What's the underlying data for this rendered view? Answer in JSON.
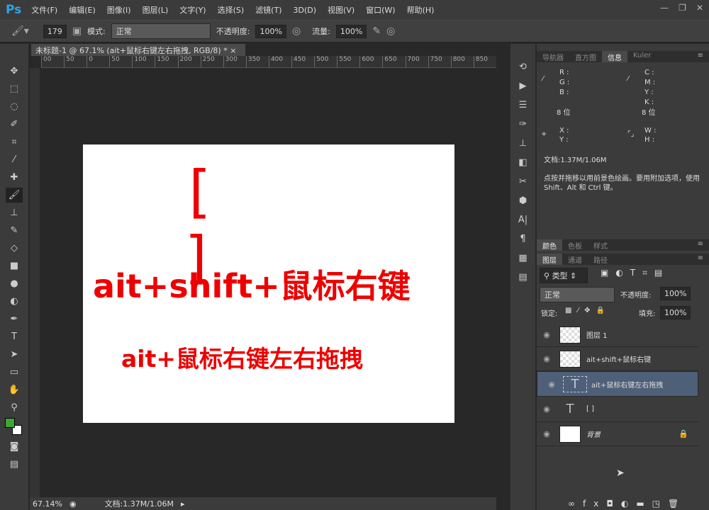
{
  "app": {
    "logo": "Ps",
    "menu": [
      "文件(F)",
      "编辑(E)",
      "图像(I)",
      "图层(L)",
      "文字(Y)",
      "选择(S)",
      "滤镜(T)",
      "3D(D)",
      "视图(V)",
      "窗口(W)",
      "帮助(H)"
    ],
    "window_buttons": [
      "—",
      "❐",
      "✕"
    ]
  },
  "options": {
    "brush_size": "179",
    "mode_label": "模式:",
    "mode_value": "正常",
    "opacity_label": "不透明度:",
    "opacity_value": "100%",
    "flow_label": "流量:",
    "flow_value": "100%"
  },
  "document": {
    "tab_title": "未标题-1 @ 67.1% (ait+鼠标右键左右拖拽, RGB/8) *",
    "close": "×",
    "ruler_ticks": [
      "00",
      "50",
      "0",
      "50",
      "100",
      "150",
      "200",
      "250",
      "300",
      "350",
      "400",
      "450",
      "500",
      "550",
      "600",
      "650",
      "700",
      "750",
      "800",
      "850"
    ],
    "canvas_text": {
      "brackets": "[ ]",
      "line1": "ait+shift+鼠标右键",
      "line2": "ait+鼠标右键左右拖拽",
      "color": "#e00000"
    }
  },
  "status": {
    "zoom": "67.14%",
    "doc": "文档:1.37M/1.06M"
  },
  "panels": {
    "top_tabs": [
      "导航器",
      "直方图",
      "信息",
      "Kuler"
    ],
    "active_top": "信息",
    "info": {
      "rgb": [
        "R :",
        "G :",
        "B :"
      ],
      "cmyk": [
        "C :",
        "M :",
        "Y :",
        "K :"
      ],
      "bits_left": "8 位",
      "bits_right": "8 位",
      "xy": [
        "X :",
        "Y :"
      ],
      "wh": [
        "W :",
        "H :"
      ],
      "doc": "文档:1.37M/1.06M",
      "hint": "点按并拖移以用前景色绘画。要用附加选项，使用 Shift、Alt 和 Ctrl 键。"
    },
    "color_tabs": [
      "颜色",
      "色板",
      "样式"
    ],
    "layer_tabs": [
      "图层",
      "通道",
      "路径"
    ],
    "layers_panel": {
      "filter": "类型",
      "blend": "正常",
      "opacity_label": "不透明度:",
      "opacity": "100%",
      "lock_label": "锁定:",
      "fill_label": "填充:",
      "fill": "100%",
      "layers": [
        {
          "name": "图层 1",
          "type": "pixel"
        },
        {
          "name": "ait+shift+鼠标右键",
          "type": "pixel"
        },
        {
          "name": "ait+鼠标右键左右拖拽",
          "type": "text",
          "selected": true
        },
        {
          "name": "[ ]",
          "type": "text"
        },
        {
          "name": "背景",
          "type": "background",
          "locked": true
        }
      ]
    }
  },
  "colors": {
    "accent": "#2fa3e6",
    "foreground": "#3fa535",
    "background": "#ffffff",
    "selection": "#4e5f78"
  }
}
